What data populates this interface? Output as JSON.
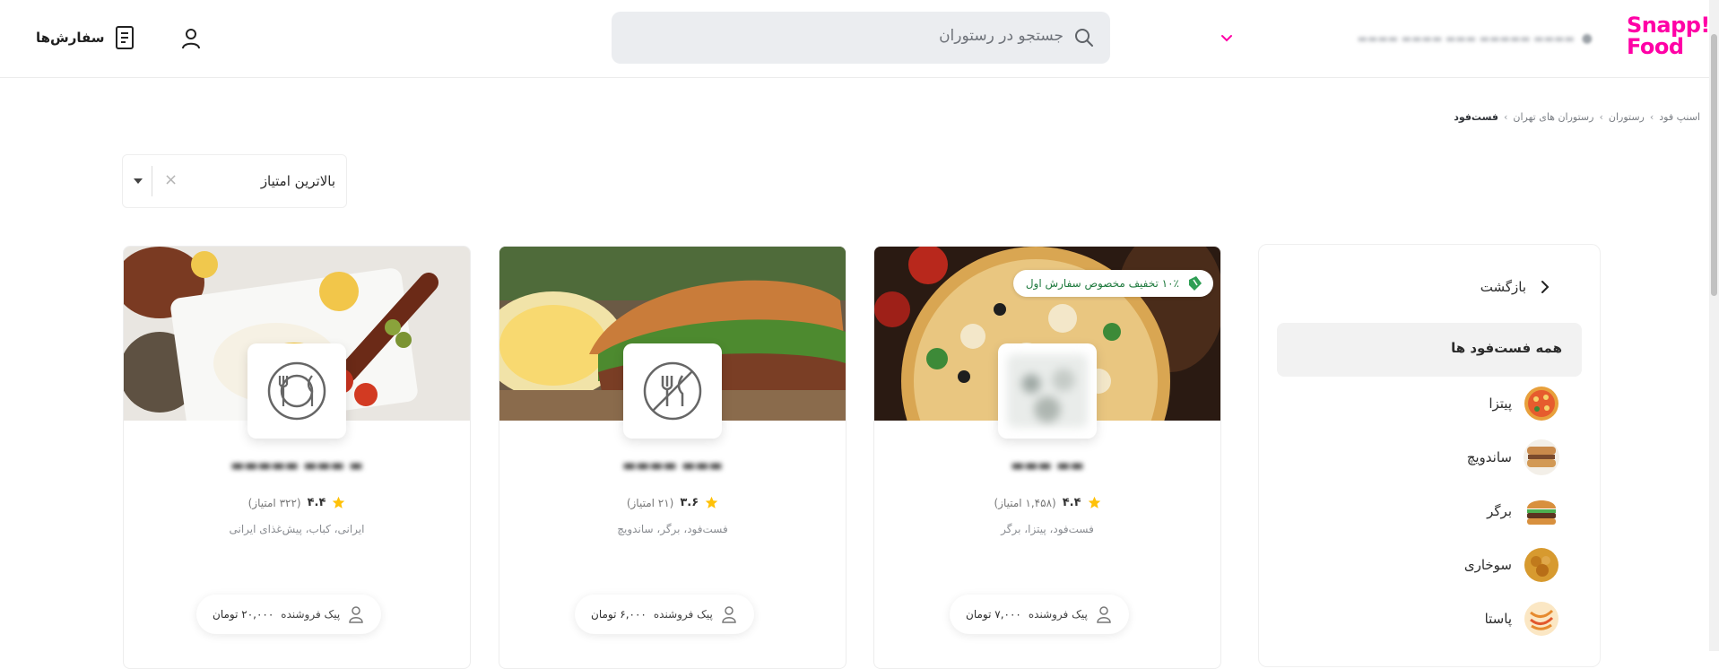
{
  "header": {
    "logo_line1": "Snapp!",
    "logo_line2": "Food",
    "search_placeholder": "جستجو در رستوران",
    "orders_label": "سفارش‌ها"
  },
  "breadcrumb": [
    "اسنپ فود",
    "رستوران",
    "رستوران های تهران",
    "فست‌فود"
  ],
  "sort": {
    "value": "بالاترین امتیاز",
    "clear": "×"
  },
  "sidebar": {
    "back_label": "بازگشت",
    "all_label": "همه فست‌فود ها",
    "categories": [
      {
        "label": "پیتزا",
        "icon": "pizza-icon"
      },
      {
        "label": "ساندویچ",
        "icon": "sandwich-icon"
      },
      {
        "label": "برگر",
        "icon": "burger-icon"
      },
      {
        "label": "سوخاری",
        "icon": "fried-chicken-icon"
      },
      {
        "label": "پاستا",
        "icon": "pasta-icon"
      }
    ]
  },
  "restaurants": [
    {
      "rating": "۴.۴",
      "reviews": "(۱,۴۵۸ امتیاز)",
      "tags": "فست‌فود، پیتزا، برگر",
      "delivery_label": "پیک فروشنده",
      "delivery_price": "۷,۰۰۰ تومان",
      "badge": "۱۰٪ تخفیف مخصوص سفارش اول"
    },
    {
      "rating": "۳.۶",
      "reviews": "(۲۱ امتیاز)",
      "tags": "فست‌فود، برگر، ساندویچ",
      "delivery_label": "پیک فروشنده",
      "delivery_price": "۶,۰۰۰ تومان"
    },
    {
      "rating": "۴.۴",
      "reviews": "(۳۲۲ امتیاز)",
      "tags": "ایرانی، کباب، پیش‌غذای ایرانی",
      "delivery_label": "پیک فروشنده",
      "delivery_price": "۲۰,۰۰۰ تومان"
    }
  ],
  "colors": {
    "brand": "#ff00a6",
    "star": "#ffc107",
    "badge_text": "#1f7a3e"
  }
}
